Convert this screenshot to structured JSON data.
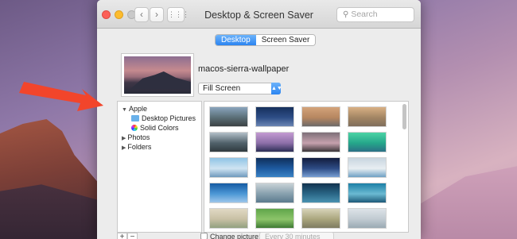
{
  "window": {
    "title": "Desktop & Screen Saver",
    "search_placeholder": "Search",
    "nav_back": "‹",
    "nav_forward": "›",
    "nav_grid": "⋮⋮⋮"
  },
  "tabs": [
    {
      "label": "Desktop",
      "active": true
    },
    {
      "label": "Screen Saver",
      "active": false
    }
  ],
  "current_wallpaper": {
    "name": "macos-sierra-wallpaper",
    "fit_option": "Fill Screen"
  },
  "sidebar": {
    "items": [
      {
        "label": "Apple",
        "expanded": true,
        "level": 0
      },
      {
        "label": "Desktop Pictures",
        "level": 1,
        "icon": "folder-icon"
      },
      {
        "label": "Solid Colors",
        "level": 1,
        "icon": "color-wheel-icon"
      },
      {
        "label": "Photos",
        "expanded": false,
        "level": 0
      },
      {
        "label": "Folders",
        "expanded": false,
        "level": 0
      }
    ]
  },
  "thumbnails": [
    {
      "colors": [
        "#8aa5bd",
        "#5a6e76",
        "#3b4244"
      ]
    },
    {
      "colors": [
        "#16305c",
        "#2e4e87",
        "#6c86b3"
      ]
    },
    {
      "colors": [
        "#d3a37a",
        "#b68660",
        "#6d6a69"
      ]
    },
    {
      "colors": [
        "#d9b084",
        "#a28563",
        "#7f6e5c"
      ]
    },
    {
      "colors": [
        "#b2bfc8",
        "#50616a",
        "#2f3a3f"
      ]
    },
    {
      "colors": [
        "#c39ad1",
        "#8d6fa9",
        "#2b2e55"
      ]
    },
    {
      "colors": [
        "#7d6f78",
        "#c6a1ad",
        "#3b3639"
      ]
    },
    {
      "colors": [
        "#4bd3a5",
        "#25a78a",
        "#2b7186"
      ]
    },
    {
      "colors": [
        "#8fc4e5",
        "#cfe4f2",
        "#6f99bd"
      ]
    },
    {
      "colors": [
        "#0f2f5a",
        "#1e5aa0",
        "#3b84c5"
      ]
    },
    {
      "colors": [
        "#121c3d",
        "#2e4c85",
        "#7aa0d3"
      ]
    },
    {
      "colors": [
        "#c8d5df",
        "#e8eef2",
        "#6ea0c4"
      ]
    },
    {
      "colors": [
        "#155ba3",
        "#4d98d6",
        "#9dc6ea"
      ]
    },
    {
      "colors": [
        "#c9d2d6",
        "#87a0ae",
        "#5b7a8d"
      ]
    },
    {
      "colors": [
        "#12334f",
        "#2a6686",
        "#4a92b1"
      ]
    },
    {
      "colors": [
        "#1c7fa6",
        "#6bbad2",
        "#1d5a79"
      ]
    },
    {
      "colors": [
        "#e1d9c4",
        "#c8c0a4",
        "#92a07f"
      ]
    },
    {
      "colors": [
        "#5fa54a",
        "#8cc46a",
        "#3e7a33"
      ]
    },
    {
      "colors": [
        "#d7d3b8",
        "#a9a57d",
        "#7e7b61"
      ]
    },
    {
      "colors": [
        "#dde3e8",
        "#c0cad1",
        "#9aa9b3"
      ]
    }
  ],
  "footer": {
    "add": "+",
    "remove": "−",
    "change_picture_label": "Change picture:",
    "interval": "Every 30 minutes"
  },
  "colors": {
    "arrow": "#f2452b",
    "accent": "#2b84f1"
  }
}
